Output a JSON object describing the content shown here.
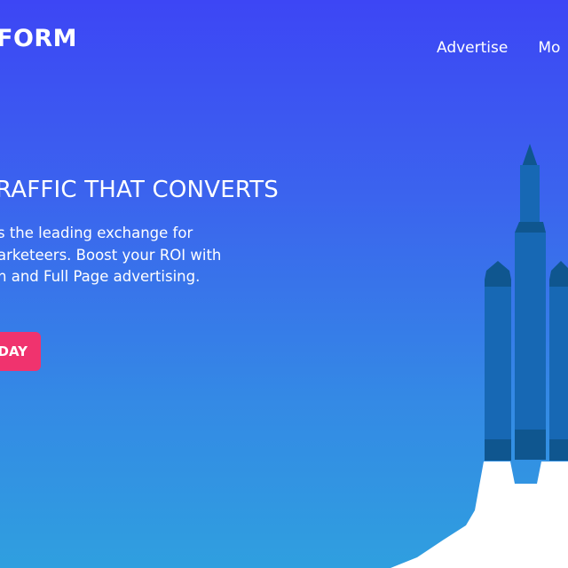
{
  "header": {
    "logo_text": "FORM",
    "nav": [
      "Advertise",
      "Mo"
    ]
  },
  "hero": {
    "title": "RAFFIC THAT CONVERTS",
    "lines": [
      "s the leading exchange for",
      "arketeers. Boost your ROI with",
      "n and Full Page advertising."
    ],
    "cta_label": "DAY"
  },
  "colors": {
    "background_top": "#3d46f5",
    "background_bottom": "#2f9fdf",
    "cta": "#f0336e",
    "rocket_body": "#1768b4",
    "rocket_dark": "#0f568f",
    "smoke": "#ffffff"
  },
  "icons": {
    "illustration": "rocket-illustration"
  }
}
